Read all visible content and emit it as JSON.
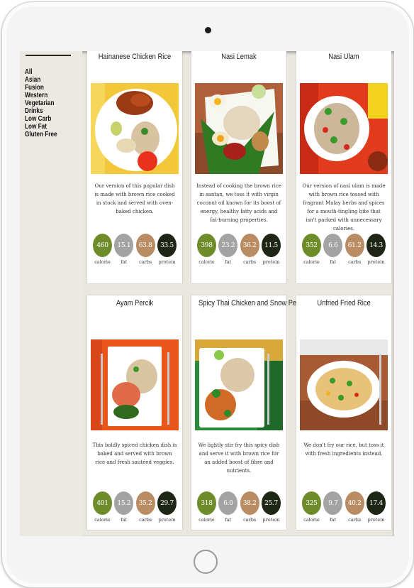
{
  "filters": [
    "All",
    "Asian",
    "Fusion",
    "Western",
    "Vegetarian",
    "Drinks",
    "Low Carb",
    "Low Fat",
    "Gluten Free"
  ],
  "nutrient_labels": {
    "calorie": "calorie",
    "fat": "fat",
    "carbs": "carbs",
    "protein": "protein"
  },
  "dishes": [
    {
      "title": "Hainanese Chicken Rice",
      "description": "Our version of this popular dish is made with brown rice cooked in stock and served with oven-baked chicken.",
      "calorie": "460",
      "fat": "15.1",
      "carbs": "63.8",
      "protein": "33.5"
    },
    {
      "title": "Nasi Lemak",
      "description": "Instead of cooking the brown rice in santan, we toss it with virgin coconut oil known for its boost of energy, healthy fatty acids and fat-burning properties.",
      "calorie": "398",
      "fat": "23.2",
      "carbs": "36.2",
      "protein": "11.5"
    },
    {
      "title": "Nasi Ulam",
      "description": "Our version of nasi ulam is made with brown rice tossed with fragrant Malay herbs and spices for a mouth-tingling bite that isn't packed with unnecessary calories.",
      "calorie": "352",
      "fat": "6.6",
      "carbs": "61.2",
      "protein": "14.3"
    },
    {
      "title": "Ayam Percik",
      "description": "This boldly spiced chicken dish is baked and served with brown rice and fresh sautéed veggies.",
      "calorie": "401",
      "fat": "15.2",
      "carbs": "35.2",
      "protein": "29.7"
    },
    {
      "title": "Spicy Thai Chicken and Snow Pea Stirfry",
      "description": "We lightly stir fry this spicy dish and serve it with brown rice for an added boost of fibre and nutrients.",
      "calorie": "318",
      "fat": "6.0",
      "carbs": "38.2",
      "protein": "25.7"
    },
    {
      "title": "Unfried Fried Rice",
      "description": "We don't fry our rice, but toss it with fresh ingredients instead.",
      "calorie": "325",
      "fat": "9.7",
      "carbs": "40.2",
      "protein": "17.4"
    }
  ]
}
